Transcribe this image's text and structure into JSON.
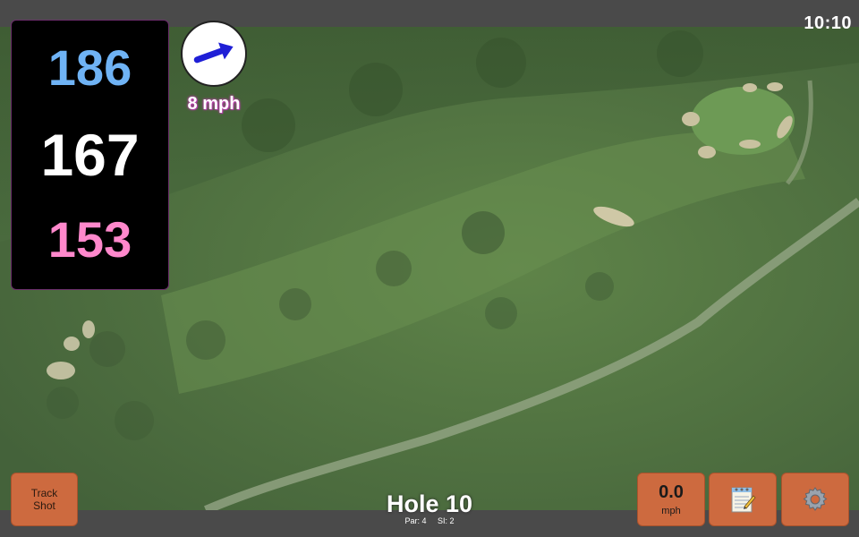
{
  "status": {
    "time": "10:10"
  },
  "yardages": {
    "back": "186",
    "middle": "167",
    "front": "153"
  },
  "wind": {
    "speed": "8 mph",
    "direction_deg": -20
  },
  "hole": {
    "title": "Hole 10",
    "par": "Par: 4",
    "si": "SI: 2"
  },
  "buttons": {
    "track_shot_line1": "Track",
    "track_shot_line2": "Shot",
    "speed_value": "0.0",
    "speed_unit": "mph",
    "notes_icon": "notepad-icon",
    "settings_icon": "gear-icon"
  },
  "colors": {
    "back": "#6fb3f5",
    "middle": "#ffffff",
    "front": "#ff88cc",
    "button": "#cd6a3f",
    "wind_arrow": "#1f1fd6"
  }
}
